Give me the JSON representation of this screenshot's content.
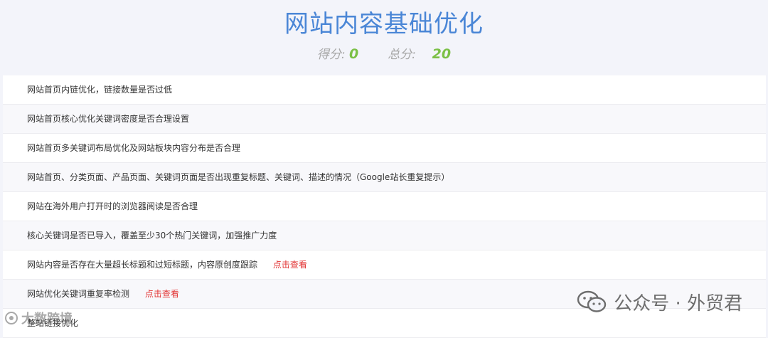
{
  "header": {
    "title": "网站内容基础优化",
    "score_label": "得分:",
    "score_value": "0",
    "total_label": "总分:",
    "total_value": "20"
  },
  "items": [
    {
      "text": "网站首页内链优化，链接数量是否过低",
      "link": ""
    },
    {
      "text": "网站首页核心优化关键词密度是否合理设置",
      "link": ""
    },
    {
      "text": "网站首页多关键词布局优化及网站板块内容分布是否合理",
      "link": ""
    },
    {
      "text": "网站首页、分类页面、产品页面、关键词页面是否出现重复标题、关键词、描述的情况（Google站长重复提示）",
      "link": ""
    },
    {
      "text": "网站在海外用户打开时的浏览器阅读是否合理",
      "link": ""
    },
    {
      "text": "核心关键词是否已导入，覆盖至少30个热门关键词，加强推广力度",
      "link": ""
    },
    {
      "text": "网站内容是否存在大量超长标题和过短标题，内容原创度跟踪",
      "link": "点击查看"
    },
    {
      "text": "网站优化关键词重复率检测",
      "link": "点击查看"
    },
    {
      "text": "整站链接优化",
      "link": ""
    }
  ],
  "watermark": {
    "text": "公众号 · 外贸君",
    "corner_text": "大数跨境"
  },
  "colors": {
    "title": "#4a86d6",
    "score": "#7bc046",
    "link": "#e23333"
  }
}
